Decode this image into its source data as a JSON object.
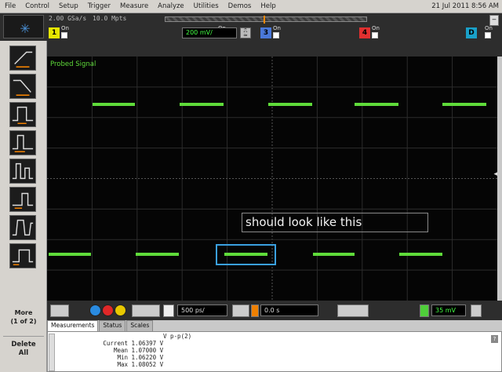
{
  "menu": {
    "items": [
      "File",
      "Control",
      "Setup",
      "Trigger",
      "Measure",
      "Analyze",
      "Utilities",
      "Demos",
      "Help"
    ],
    "datetime": "21 Jul 2011  8:56 AM"
  },
  "acquisition": {
    "sample_rate": "2.00 GSa/s",
    "memory_depth": "10.0 Mpts"
  },
  "channels": [
    {
      "number": "1",
      "state": "On",
      "color": "#e6e600"
    },
    {
      "number": "2",
      "state": "On",
      "color": "#4fcf3a",
      "scale": "200 mV/"
    },
    {
      "number": "3",
      "state": "On",
      "color": "#4a78d8"
    },
    {
      "number": "4",
      "state": "On",
      "color": "#e03030"
    },
    {
      "number": "D",
      "state": "On",
      "color": "#1aa0c8"
    }
  ],
  "left_toolbar": {
    "tools": [
      "rising-edge-icon",
      "falling-edge-icon",
      "pulse-width-icon",
      "glitch-icon",
      "runt-icon",
      "setup-hold-icon",
      "transition-icon",
      "timeout-icon"
    ],
    "more_label": "More",
    "more_pages": "(1 of 2)",
    "delete_label": "Delete",
    "delete_all": "All"
  },
  "display": {
    "trace_label": "Probed Signal",
    "annotation": "should look like this",
    "trace_color": "#5fdc3a",
    "highlight_color": "#3aa0e0"
  },
  "bottom": {
    "timebase": "500 ps/",
    "position": "0.0 s",
    "trigger_level": "35 mV"
  },
  "measurements": {
    "tabs": [
      "Measurements",
      "Status",
      "Scales"
    ],
    "column_header": "V p-p(2)",
    "rows": [
      {
        "label": "Current",
        "value": "1.06397 V"
      },
      {
        "label": "Mean",
        "value": "1.07000 V"
      },
      {
        "label": "Min",
        "value": "1.06220 V"
      },
      {
        "label": "Max",
        "value": "1.08052 V"
      }
    ],
    "help": "?"
  }
}
